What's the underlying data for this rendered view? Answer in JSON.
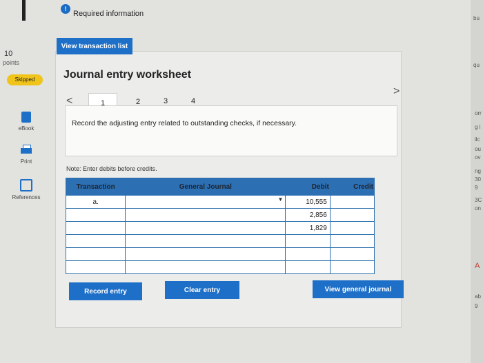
{
  "header": {
    "alert_icon": "!",
    "required_info": "Required information",
    "view_transaction_list": "View transaction list"
  },
  "sidebar": {
    "points_value": "10",
    "points_label": "points",
    "status_badge": "Skipped",
    "items": [
      {
        "icon": "ebook-icon",
        "label": "eBook"
      },
      {
        "icon": "print-icon",
        "label": "Print"
      },
      {
        "icon": "references-icon",
        "label": "References"
      }
    ]
  },
  "worksheet": {
    "title": "Journal entry worksheet",
    "prev_arrow": "<",
    "next_arrow": ">",
    "tabs": [
      "1",
      "2",
      "3",
      "4"
    ],
    "instruction": "Record the adjusting entry related to outstanding checks, if necessary.",
    "note": "Note: Enter debits before credits."
  },
  "table": {
    "headers": [
      "Transaction",
      "General Journal",
      "Debit",
      "Credit"
    ],
    "rows": [
      {
        "transaction": "a.",
        "account": "",
        "debit": "10,555",
        "credit": ""
      },
      {
        "transaction": "",
        "account": "",
        "debit": "2,856",
        "credit": ""
      },
      {
        "transaction": "",
        "account": "",
        "debit": "1,829",
        "credit": ""
      },
      {
        "transaction": "",
        "account": "",
        "debit": "",
        "credit": ""
      },
      {
        "transaction": "",
        "account": "",
        "debit": "",
        "credit": ""
      },
      {
        "transaction": "",
        "account": "",
        "debit": "",
        "credit": ""
      }
    ]
  },
  "buttons": {
    "record_entry": "Record entry",
    "clear_entry": "Clear entry",
    "view_general_journal": "View general journal"
  },
  "right_edge": [
    "bu",
    "qu",
    "orr",
    "g l",
    "ilc",
    "ou",
    "ov",
    "ng",
    "30",
    "9",
    "3C",
    "on",
    "A",
    "ab",
    "9"
  ]
}
